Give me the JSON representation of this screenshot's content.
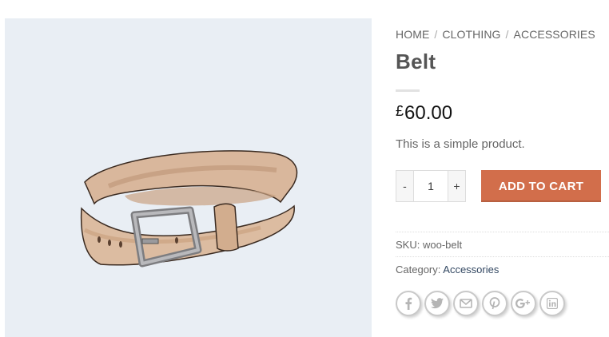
{
  "breadcrumb": {
    "items": [
      "HOME",
      "CLOTHING",
      "ACCESSORIES"
    ],
    "separator": "/"
  },
  "product": {
    "title": "Belt",
    "currency": "£",
    "price": "60.00",
    "short_description": "This is a simple product.",
    "image_icon": "belt-illustration"
  },
  "cart": {
    "minus_label": "-",
    "plus_label": "+",
    "quantity": "1",
    "add_to_cart_label": "ADD TO CART"
  },
  "meta": {
    "sku_label": "SKU:",
    "sku_value": "woo-belt",
    "category_label": "Category:",
    "category_value": "Accessories"
  },
  "share": {
    "icons": [
      "facebook-icon",
      "twitter-icon",
      "email-icon",
      "pinterest-icon",
      "google-plus-icon",
      "linkedin-icon"
    ]
  },
  "colors": {
    "accent": "#d26e4b",
    "link": "#334862",
    "image_bg": "#e9eef4"
  }
}
